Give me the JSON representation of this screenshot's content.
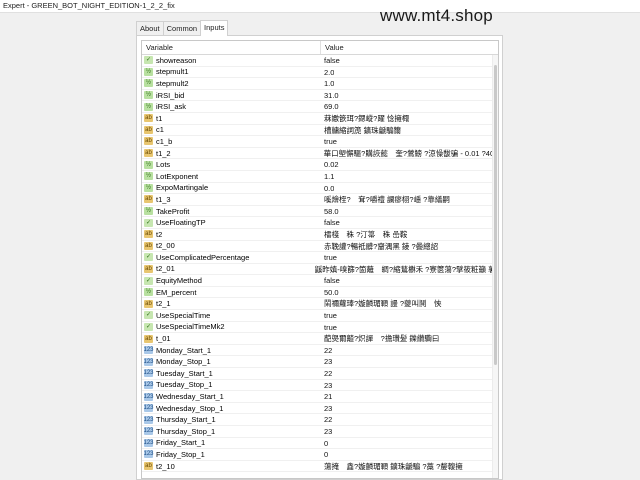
{
  "window": {
    "title": "Expert - GREEN_BOT_NIGHT_EDITION-1_2_2_fix"
  },
  "watermark": "www.mt4.shop",
  "tabs": [
    {
      "label": "About",
      "active": false
    },
    {
      "label": "Common",
      "active": false
    },
    {
      "label": "Inputs",
      "active": true
    }
  ],
  "table": {
    "headers": {
      "variable": "Variable",
      "value": "Value"
    },
    "rows": [
      {
        "icon": "bool-icon",
        "name": "showreason",
        "value": "false"
      },
      {
        "icon": "float-icon",
        "name": "stepmult1",
        "value": "2.0"
      },
      {
        "icon": "float-icon",
        "name": "stepmult2",
        "value": "1.0"
      },
      {
        "icon": "float-icon",
        "name": "iRSI_bid",
        "value": "31.0"
      },
      {
        "icon": "float-icon",
        "name": "iRSI_ask",
        "value": "69.0"
      },
      {
        "icon": "string-icon",
        "name": "t1",
        "value": "菻嫐篏珥?鍶嵷?躍 惗擁棷"
      },
      {
        "icon": "string-icon",
        "name": "c1",
        "value": "槽牗縮詞箎 鑛珠䶵騸籋"
      },
      {
        "icon": "string-icon",
        "name": "c1_b",
        "value": "true"
      },
      {
        "icon": "string-icon",
        "name": "t1_2",
        "value": "華口塱懈驅?購詼懿　奎?鶯鰟 ?涼懆馛骗 - 0.01 ?400"
      },
      {
        "icon": "float-icon",
        "name": "Lots",
        "value": "0.02"
      },
      {
        "icon": "float-icon",
        "name": "LotExponent",
        "value": "1.1"
      },
      {
        "icon": "float-icon",
        "name": "ExpoMartingale",
        "value": "0.0"
      },
      {
        "icon": "string-icon",
        "name": "t1_3",
        "value": "嗘燴桎?　耷?嚼禮 讕瘳栩?嶾 ?靠繕嗣"
      },
      {
        "icon": "float-icon",
        "name": "TakeProfit",
        "value": "58.0"
      },
      {
        "icon": "bool-icon",
        "name": "UseFloatingTP",
        "value": "false"
      },
      {
        "icon": "string-icon",
        "name": "t2",
        "value": "檑棧　秼 ?汀箒　秼 嵒鞍"
      },
      {
        "icon": "string-icon",
        "name": "t2_00",
        "value": "赤鞔讙?暢祗髒?齏湡黑 錂 ?曡總詔"
      },
      {
        "icon": "bool-icon",
        "name": "UseComplicatedPercentage",
        "value": "true"
      },
      {
        "icon": "string-icon",
        "name": "t2_01",
        "value": "鼷昨嫃-嗅篩?箇蘺　皗?縮鶿欁禾 ?寮篋蕩?擘筱粧籲 薯 2..."
      },
      {
        "icon": "bool-icon",
        "name": "EquityMethod",
        "value": "false"
      },
      {
        "icon": "float-icon",
        "name": "EM_percent",
        "value": "50.0"
      },
      {
        "icon": "string-icon",
        "name": "t2_1",
        "value": "鬧禰蘿琫?嫙麟瑂顐 謾 ?夔叫鬨　悏"
      },
      {
        "icon": "bool-icon",
        "name": "UseSpecialTime",
        "value": "true"
      },
      {
        "icon": "bool-icon",
        "name": "UseSpecialTimeMk2",
        "value": "true"
      },
      {
        "icon": "string-icon",
        "name": "t_01",
        "value": "蓜爂爾齄?炽譂　?擔瓚髪 鑠纘驧曰"
      },
      {
        "icon": "int-icon",
        "name": "Monday_Start_1",
        "value": "22"
      },
      {
        "icon": "int-icon",
        "name": "Monday_Stop_1",
        "value": "23"
      },
      {
        "icon": "int-icon",
        "name": "Tuesday_Start_1",
        "value": "22"
      },
      {
        "icon": "int-icon",
        "name": "Tuesday_Stop_1",
        "value": "23"
      },
      {
        "icon": "int-icon",
        "name": "Wednesday_Start_1",
        "value": "21"
      },
      {
        "icon": "int-icon",
        "name": "Wednesday_Stop_1",
        "value": "23"
      },
      {
        "icon": "int-icon",
        "name": "Thursday_Start_1",
        "value": "22"
      },
      {
        "icon": "int-icon",
        "name": "Thursday_Stop_1",
        "value": "23"
      },
      {
        "icon": "int-icon",
        "name": "Friday_Start_1",
        "value": "0"
      },
      {
        "icon": "int-icon",
        "name": "Friday_Stop_1",
        "value": "0"
      },
      {
        "icon": "string-icon",
        "name": "t2_10",
        "value": "蕩掩　鑫?嫙麟瑂顐 鑛珠䶵騸 ?藁 ?嫠輹擁"
      }
    ]
  }
}
